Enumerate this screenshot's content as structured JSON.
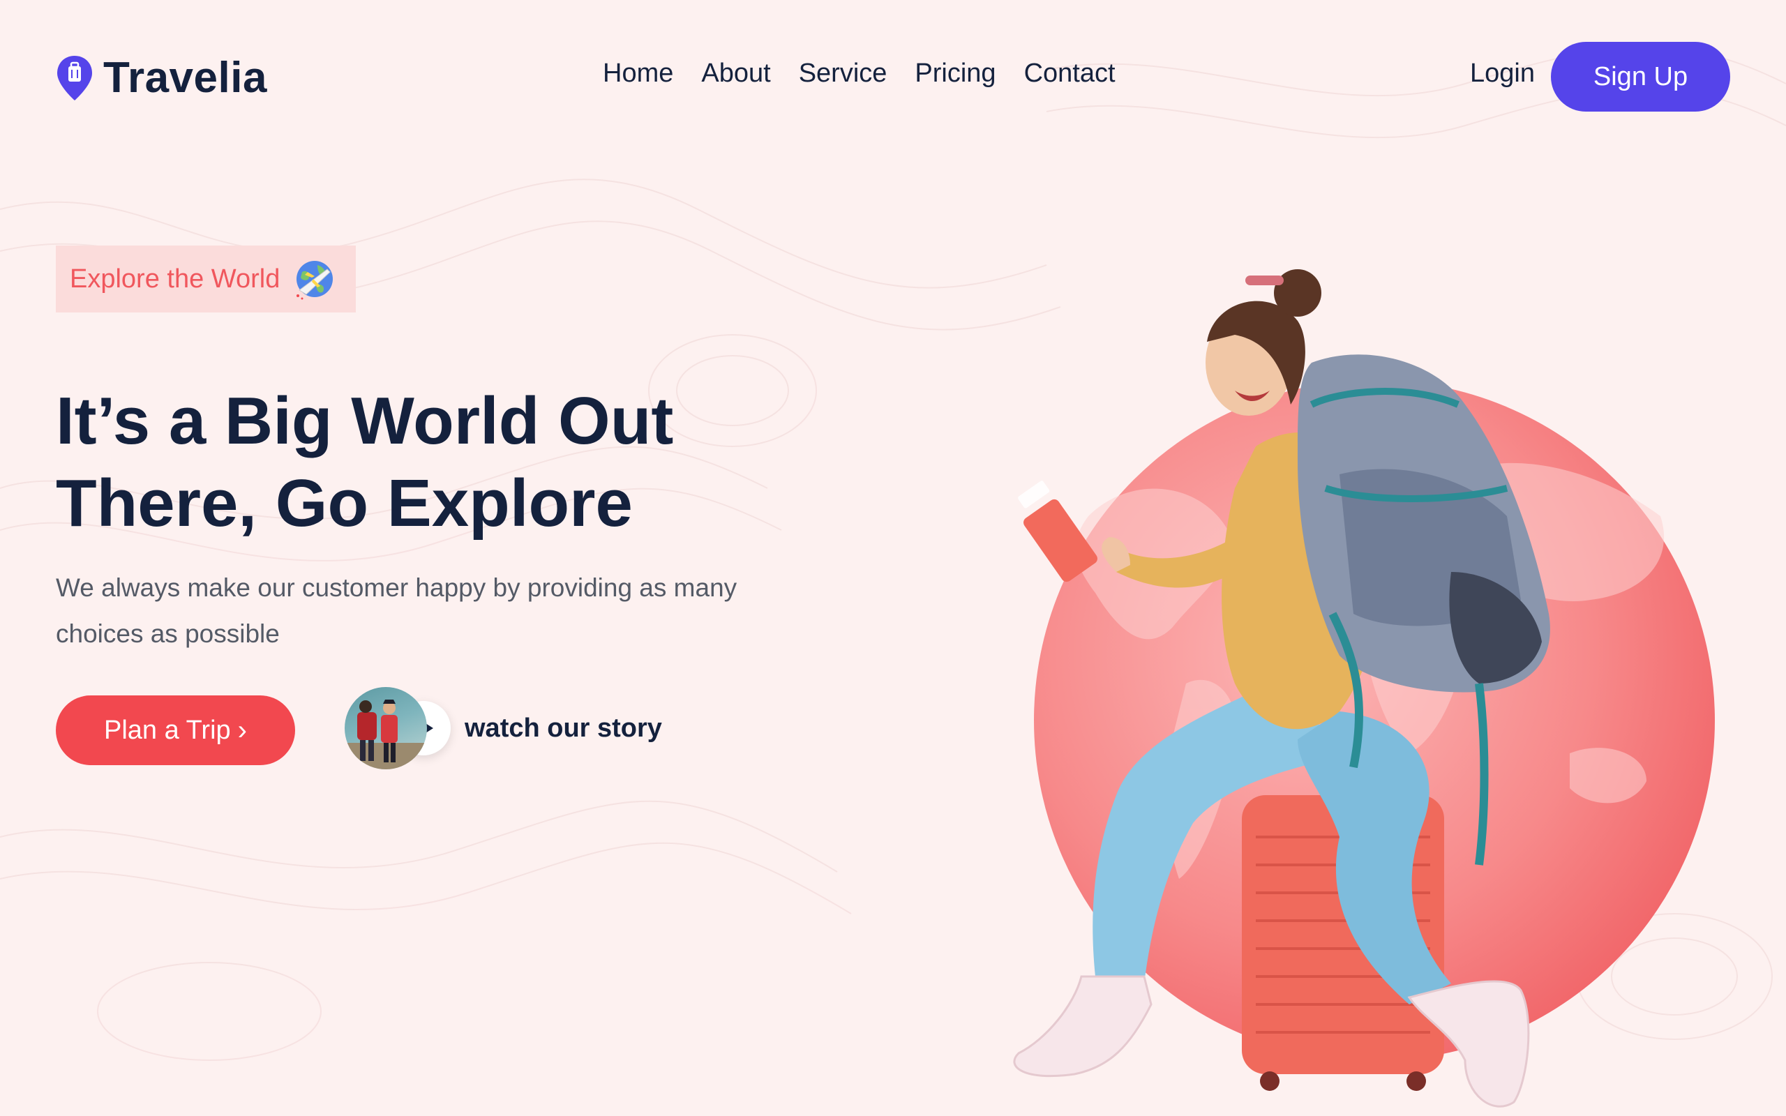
{
  "brand": {
    "name": "Travelia",
    "accent_color": "#5544ea",
    "primary_color": "#f2484f",
    "icon": "location-pin-suitcase-icon"
  },
  "nav": {
    "items": [
      "Home",
      "About",
      "Service",
      "Pricing",
      "Contact"
    ]
  },
  "auth": {
    "login_label": "Login",
    "signup_label": "Sign Up"
  },
  "hero": {
    "badge": {
      "text": "Explore the World",
      "icon": "globe-airplane-icon"
    },
    "headline_line1": "It’s a Big World Out",
    "headline_line2": "There, Go Explore",
    "subtext": "We always make our customer happy by providing as many choices as possible",
    "cta_label": "Plan a Trip",
    "cta_icon": "chevron-right-icon",
    "story_label": "watch our story",
    "story_icon": "play-icon",
    "image": "traveler-woman-with-backpack-on-suitcase-over-world-map-circle"
  }
}
